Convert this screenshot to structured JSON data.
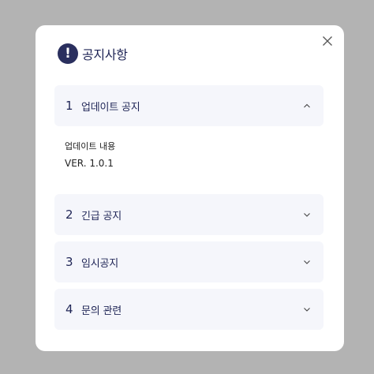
{
  "dialog": {
    "title": "공지사항",
    "alert_icon_glyph": "!",
    "close_icon": "close-icon"
  },
  "notices": [
    {
      "number": "1",
      "label": "업데이트 공지",
      "expanded": true
    },
    {
      "number": "2",
      "label": "긴급 공지",
      "expanded": false
    },
    {
      "number": "3",
      "label": "임시공지",
      "expanded": false
    },
    {
      "number": "4",
      "label": "문의 관련",
      "expanded": false
    }
  ],
  "expanded_content": {
    "heading": "업데이트 내용",
    "version": "VER. 1.0.1"
  },
  "colors": {
    "overlay": "#b3b3b3",
    "dialog_bg": "#ffffff",
    "accent": "#2a2f5e",
    "item_bg": "#f5f6fb",
    "text": "#1f2556"
  }
}
